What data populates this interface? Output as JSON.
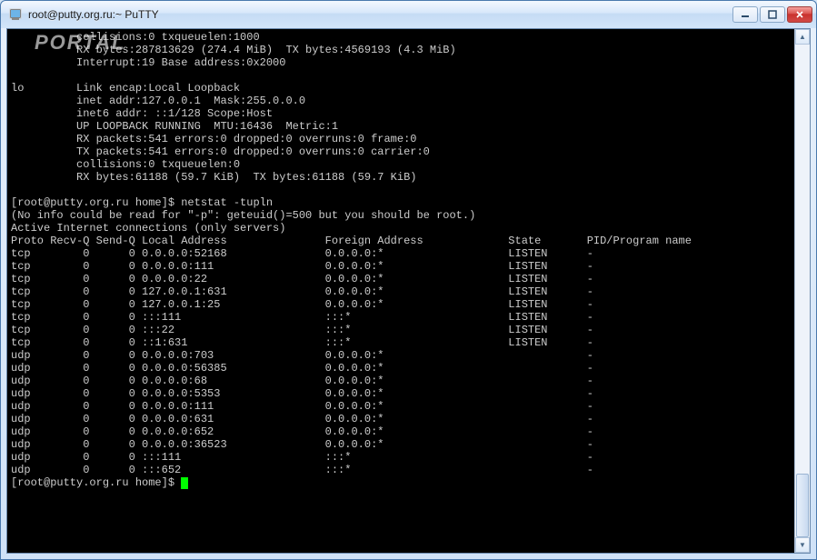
{
  "window": {
    "title": "root@putty.org.ru:~ PuTTY"
  },
  "watermark": "PORTAL",
  "ifconfig": {
    "eth_lines": [
      "          collisions:0 txqueuelen:1000",
      "          RX bytes:287813629 (274.4 MiB)  TX bytes:4569193 (4.3 MiB)",
      "          Interrupt:19 Base address:0x2000"
    ],
    "lo_lines": [
      "lo        Link encap:Local Loopback",
      "          inet addr:127.0.0.1  Mask:255.0.0.0",
      "          inet6 addr: ::1/128 Scope:Host",
      "          UP LOOPBACK RUNNING  MTU:16436  Metric:1",
      "          RX packets:541 errors:0 dropped:0 overruns:0 frame:0",
      "          TX packets:541 errors:0 dropped:0 overruns:0 carrier:0",
      "          collisions:0 txqueuelen:0",
      "          RX bytes:61188 (59.7 KiB)  TX bytes:61188 (59.7 KiB)"
    ]
  },
  "prompt1": "[root@putty.org.ru home]$ ",
  "command1": "netstat -tupln",
  "netstat_warn": "(No info could be read for \"-p\": geteuid()=500 but you should be root.)",
  "netstat_title": "Active Internet connections (only servers)",
  "netstat_header": {
    "proto": "Proto",
    "recvq": "Recv-Q",
    "sendq": "Send-Q",
    "local": "Local Address",
    "foreign": "Foreign Address",
    "state": "State",
    "pid": "PID/Program name"
  },
  "netstat_rows": [
    {
      "proto": "tcp",
      "recvq": "0",
      "sendq": "0",
      "local": "0.0.0.0:52168",
      "foreign": "0.0.0.0:*",
      "state": "LISTEN",
      "pid": "-"
    },
    {
      "proto": "tcp",
      "recvq": "0",
      "sendq": "0",
      "local": "0.0.0.0:111",
      "foreign": "0.0.0.0:*",
      "state": "LISTEN",
      "pid": "-"
    },
    {
      "proto": "tcp",
      "recvq": "0",
      "sendq": "0",
      "local": "0.0.0.0:22",
      "foreign": "0.0.0.0:*",
      "state": "LISTEN",
      "pid": "-"
    },
    {
      "proto": "tcp",
      "recvq": "0",
      "sendq": "0",
      "local": "127.0.0.1:631",
      "foreign": "0.0.0.0:*",
      "state": "LISTEN",
      "pid": "-"
    },
    {
      "proto": "tcp",
      "recvq": "0",
      "sendq": "0",
      "local": "127.0.0.1:25",
      "foreign": "0.0.0.0:*",
      "state": "LISTEN",
      "pid": "-"
    },
    {
      "proto": "tcp",
      "recvq": "0",
      "sendq": "0",
      "local": ":::111",
      "foreign": ":::*",
      "state": "LISTEN",
      "pid": "-"
    },
    {
      "proto": "tcp",
      "recvq": "0",
      "sendq": "0",
      "local": ":::22",
      "foreign": ":::*",
      "state": "LISTEN",
      "pid": "-"
    },
    {
      "proto": "tcp",
      "recvq": "0",
      "sendq": "0",
      "local": "::1:631",
      "foreign": ":::*",
      "state": "LISTEN",
      "pid": "-"
    },
    {
      "proto": "udp",
      "recvq": "0",
      "sendq": "0",
      "local": "0.0.0.0:703",
      "foreign": "0.0.0.0:*",
      "state": "",
      "pid": "-"
    },
    {
      "proto": "udp",
      "recvq": "0",
      "sendq": "0",
      "local": "0.0.0.0:56385",
      "foreign": "0.0.0.0:*",
      "state": "",
      "pid": "-"
    },
    {
      "proto": "udp",
      "recvq": "0",
      "sendq": "0",
      "local": "0.0.0.0:68",
      "foreign": "0.0.0.0:*",
      "state": "",
      "pid": "-"
    },
    {
      "proto": "udp",
      "recvq": "0",
      "sendq": "0",
      "local": "0.0.0.0:5353",
      "foreign": "0.0.0.0:*",
      "state": "",
      "pid": "-"
    },
    {
      "proto": "udp",
      "recvq": "0",
      "sendq": "0",
      "local": "0.0.0.0:111",
      "foreign": "0.0.0.0:*",
      "state": "",
      "pid": "-"
    },
    {
      "proto": "udp",
      "recvq": "0",
      "sendq": "0",
      "local": "0.0.0.0:631",
      "foreign": "0.0.0.0:*",
      "state": "",
      "pid": "-"
    },
    {
      "proto": "udp",
      "recvq": "0",
      "sendq": "0",
      "local": "0.0.0.0:652",
      "foreign": "0.0.0.0:*",
      "state": "",
      "pid": "-"
    },
    {
      "proto": "udp",
      "recvq": "0",
      "sendq": "0",
      "local": "0.0.0.0:36523",
      "foreign": "0.0.0.0:*",
      "state": "",
      "pid": "-"
    },
    {
      "proto": "udp",
      "recvq": "0",
      "sendq": "0",
      "local": ":::111",
      "foreign": ":::*",
      "state": "",
      "pid": "-"
    },
    {
      "proto": "udp",
      "recvq": "0",
      "sendq": "0",
      "local": ":::652",
      "foreign": ":::*",
      "state": "",
      "pid": "-"
    }
  ],
  "prompt2": "[root@putty.org.ru home]$ "
}
